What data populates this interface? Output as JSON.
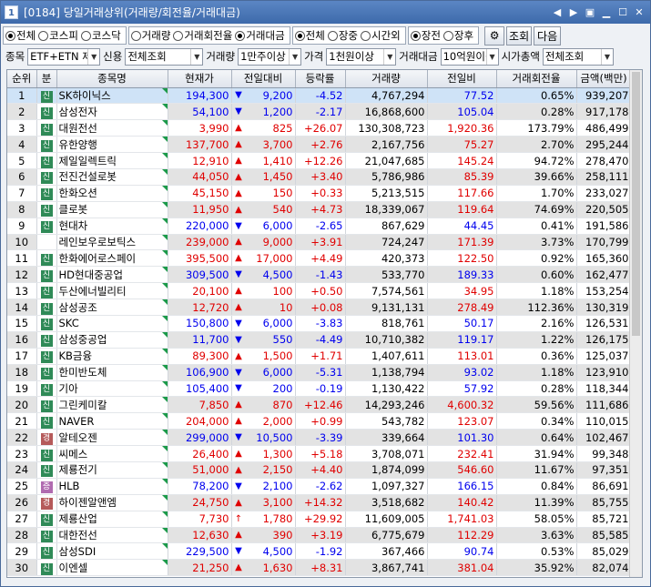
{
  "window": {
    "number": "1",
    "title": "[0184] 당일거래상위(거래량/회전율/거래대금)"
  },
  "markets": [
    {
      "label": "전체",
      "on": true
    },
    {
      "label": "코스피",
      "on": false
    },
    {
      "label": "코스닥",
      "on": false
    }
  ],
  "sortby": [
    {
      "label": "거래량",
      "on": false
    },
    {
      "label": "거래회전율",
      "on": false
    },
    {
      "label": "거래대금",
      "on": true
    }
  ],
  "session": [
    {
      "label": "전체",
      "on": true
    },
    {
      "label": "장중",
      "on": false
    },
    {
      "label": "시간외",
      "on": false
    }
  ],
  "session2": [
    {
      "label": "장전",
      "on": true
    },
    {
      "label": "장후",
      "on": false
    }
  ],
  "buttons": {
    "query": "조회",
    "next": "다음"
  },
  "filters": {
    "item_label": "종목",
    "item": "ETF+ETN 제",
    "credit_label": "신용",
    "credit": "전체조회",
    "volume_label": "거래량",
    "volume": "1만주이상",
    "price_label": "가격",
    "price": "1천원이상",
    "amount_label": "거래대금",
    "amount": "10억원이상",
    "cap_label": "시가총액",
    "cap": "전체조회"
  },
  "columns": [
    "순위",
    "분",
    "종목명",
    "현재가",
    "전일대비",
    "등락률",
    "거래량",
    "전일비",
    "거래회전율",
    "금액(백만)"
  ],
  "rows": [
    {
      "rank": "1",
      "cls": "신",
      "name": "SK하이닉스",
      "price": "194,300",
      "dir": "down",
      "chg": "9,200",
      "rate": "-4.52",
      "vol": "4,767,294",
      "prev": "77.52",
      "turn": "0.65%",
      "amt": "939,207"
    },
    {
      "rank": "2",
      "cls": "신",
      "name": "삼성전자",
      "price": "54,100",
      "dir": "down",
      "chg": "1,200",
      "rate": "-2.17",
      "vol": "16,868,600",
      "prev": "105.04",
      "turn": "0.28%",
      "amt": "917,178"
    },
    {
      "rank": "3",
      "cls": "신",
      "name": "대원전선",
      "price": "3,990",
      "dir": "up",
      "chg": "825",
      "rate": "+26.07",
      "vol": "130,308,723",
      "prev": "1,920.36",
      "turn": "173.79%",
      "amt": "486,499"
    },
    {
      "rank": "4",
      "cls": "신",
      "name": "유한양행",
      "price": "137,700",
      "dir": "up",
      "chg": "3,700",
      "rate": "+2.76",
      "vol": "2,167,756",
      "prev": "75.27",
      "turn": "2.70%",
      "amt": "295,244"
    },
    {
      "rank": "5",
      "cls": "신",
      "name": "제일일렉트릭",
      "price": "12,910",
      "dir": "up",
      "chg": "1,410",
      "rate": "+12.26",
      "vol": "21,047,685",
      "prev": "145.24",
      "turn": "94.72%",
      "amt": "278,470"
    },
    {
      "rank": "6",
      "cls": "신",
      "name": "전진건설로봇",
      "price": "44,050",
      "dir": "up",
      "chg": "1,450",
      "rate": "+3.40",
      "vol": "5,786,986",
      "prev": "85.39",
      "turn": "39.66%",
      "amt": "258,111"
    },
    {
      "rank": "7",
      "cls": "신",
      "name": "한화오션",
      "price": "45,150",
      "dir": "up",
      "chg": "150",
      "rate": "+0.33",
      "vol": "5,213,515",
      "prev": "117.66",
      "turn": "1.70%",
      "amt": "233,027"
    },
    {
      "rank": "8",
      "cls": "신",
      "name": "클로봇",
      "price": "11,950",
      "dir": "up",
      "chg": "540",
      "rate": "+4.73",
      "vol": "18,339,067",
      "prev": "119.64",
      "turn": "74.69%",
      "amt": "220,505"
    },
    {
      "rank": "9",
      "cls": "신",
      "name": "현대차",
      "price": "220,000",
      "dir": "down",
      "chg": "6,000",
      "rate": "-2.65",
      "vol": "867,629",
      "prev": "44.45",
      "turn": "0.41%",
      "amt": "191,586"
    },
    {
      "rank": "10",
      "cls": "",
      "name": "레인보우로보틱스",
      "price": "239,000",
      "dir": "up",
      "chg": "9,000",
      "rate": "+3.91",
      "vol": "724,247",
      "prev": "171.39",
      "turn": "3.73%",
      "amt": "170,799"
    },
    {
      "rank": "11",
      "cls": "신",
      "name": "한화에어로스페이",
      "price": "395,500",
      "dir": "up",
      "chg": "17,000",
      "rate": "+4.49",
      "vol": "420,373",
      "prev": "122.50",
      "turn": "0.92%",
      "amt": "165,360"
    },
    {
      "rank": "12",
      "cls": "신",
      "name": "HD현대중공업",
      "price": "309,500",
      "dir": "down",
      "chg": "4,500",
      "rate": "-1.43",
      "vol": "533,770",
      "prev": "189.33",
      "turn": "0.60%",
      "amt": "162,477"
    },
    {
      "rank": "13",
      "cls": "신",
      "name": "두산에너빌리티",
      "price": "20,100",
      "dir": "up",
      "chg": "100",
      "rate": "+0.50",
      "vol": "7,574,561",
      "prev": "34.95",
      "turn": "1.18%",
      "amt": "153,254"
    },
    {
      "rank": "14",
      "cls": "신",
      "name": "삼성공조",
      "price": "12,720",
      "dir": "up",
      "chg": "10",
      "rate": "+0.08",
      "vol": "9,131,131",
      "prev": "278.49",
      "turn": "112.36%",
      "amt": "130,319"
    },
    {
      "rank": "15",
      "cls": "신",
      "name": "SKC",
      "price": "150,800",
      "dir": "down",
      "chg": "6,000",
      "rate": "-3.83",
      "vol": "818,761",
      "prev": "50.17",
      "turn": "2.16%",
      "amt": "126,531"
    },
    {
      "rank": "16",
      "cls": "신",
      "name": "삼성중공업",
      "price": "11,700",
      "dir": "down",
      "chg": "550",
      "rate": "-4.49",
      "vol": "10,710,382",
      "prev": "119.17",
      "turn": "1.22%",
      "amt": "126,175"
    },
    {
      "rank": "17",
      "cls": "신",
      "name": "KB금융",
      "price": "89,300",
      "dir": "up",
      "chg": "1,500",
      "rate": "+1.71",
      "vol": "1,407,611",
      "prev": "113.01",
      "turn": "0.36%",
      "amt": "125,037"
    },
    {
      "rank": "18",
      "cls": "신",
      "name": "한미반도체",
      "price": "106,900",
      "dir": "down",
      "chg": "6,000",
      "rate": "-5.31",
      "vol": "1,138,794",
      "prev": "93.02",
      "turn": "1.18%",
      "amt": "123,910"
    },
    {
      "rank": "19",
      "cls": "신",
      "name": "기아",
      "price": "105,400",
      "dir": "down",
      "chg": "200",
      "rate": "-0.19",
      "vol": "1,130,422",
      "prev": "57.92",
      "turn": "0.28%",
      "amt": "118,344"
    },
    {
      "rank": "20",
      "cls": "신",
      "name": "그린케미칼",
      "price": "7,850",
      "dir": "up",
      "chg": "870",
      "rate": "+12.46",
      "vol": "14,293,246",
      "prev": "4,600.32",
      "turn": "59.56%",
      "amt": "111,686"
    },
    {
      "rank": "21",
      "cls": "신",
      "name": "NAVER",
      "price": "204,000",
      "dir": "up",
      "chg": "2,000",
      "rate": "+0.99",
      "vol": "543,782",
      "prev": "123.07",
      "turn": "0.34%",
      "amt": "110,015"
    },
    {
      "rank": "22",
      "cls": "경",
      "name": "알테오젠",
      "price": "299,000",
      "dir": "down",
      "chg": "10,500",
      "rate": "-3.39",
      "vol": "339,664",
      "prev": "101.30",
      "turn": "0.64%",
      "amt": "102,467"
    },
    {
      "rank": "23",
      "cls": "신",
      "name": "씨메스",
      "price": "26,400",
      "dir": "up",
      "chg": "1,300",
      "rate": "+5.18",
      "vol": "3,708,071",
      "prev": "232.41",
      "turn": "31.94%",
      "amt": "99,348"
    },
    {
      "rank": "24",
      "cls": "신",
      "name": "제룡전기",
      "price": "51,000",
      "dir": "up",
      "chg": "2,150",
      "rate": "+4.40",
      "vol": "1,874,099",
      "prev": "546.60",
      "turn": "11.67%",
      "amt": "97,351"
    },
    {
      "rank": "25",
      "cls": "증",
      "name": "HLB",
      "price": "78,200",
      "dir": "down",
      "chg": "2,100",
      "rate": "-2.62",
      "vol": "1,097,327",
      "prev": "166.15",
      "turn": "0.84%",
      "amt": "86,691"
    },
    {
      "rank": "26",
      "cls": "경",
      "name": "하이젠알앤엠",
      "price": "24,750",
      "dir": "up",
      "chg": "3,100",
      "rate": "+14.32",
      "vol": "3,518,682",
      "prev": "140.42",
      "turn": "11.39%",
      "amt": "85,755"
    },
    {
      "rank": "27",
      "cls": "신",
      "name": "제룡산업",
      "price": "7,730",
      "dir": "limit",
      "chg": "1,780",
      "rate": "+29.92",
      "vol": "11,609,005",
      "prev": "1,741.03",
      "turn": "58.05%",
      "amt": "85,721"
    },
    {
      "rank": "28",
      "cls": "신",
      "name": "대한전선",
      "price": "12,630",
      "dir": "up",
      "chg": "390",
      "rate": "+3.19",
      "vol": "6,775,679",
      "prev": "112.29",
      "turn": "3.63%",
      "amt": "85,585"
    },
    {
      "rank": "29",
      "cls": "신",
      "name": "삼성SDI",
      "price": "229,500",
      "dir": "down",
      "chg": "4,500",
      "rate": "-1.92",
      "vol": "367,466",
      "prev": "90.74",
      "turn": "0.53%",
      "amt": "85,029"
    },
    {
      "rank": "30",
      "cls": "신",
      "name": "이엔셀",
      "price": "21,250",
      "dir": "up",
      "chg": "1,630",
      "rate": "+8.31",
      "vol": "3,867,741",
      "prev": "381.04",
      "turn": "35.92%",
      "amt": "82,074"
    }
  ]
}
